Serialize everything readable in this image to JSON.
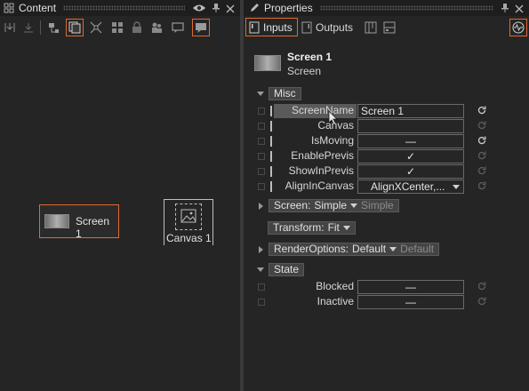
{
  "content_panel": {
    "title": "Content",
    "nodes": {
      "screen": {
        "label": "Screen 1"
      },
      "canvas": {
        "label": "Canvas 1"
      }
    }
  },
  "properties_panel": {
    "title": "Properties",
    "tabs": {
      "inputs": "Inputs",
      "outputs": "Outputs"
    },
    "object": {
      "name": "Screen 1",
      "type": "Screen"
    },
    "groups": {
      "misc": "Misc",
      "screen": {
        "label": "Screen:",
        "value": "Simple",
        "hint": "Simple"
      },
      "transform": {
        "label": "Transform:",
        "value": "Fit"
      },
      "render_options": {
        "label": "RenderOptions:",
        "value": "Default",
        "hint": "Default"
      },
      "state": "State"
    },
    "misc_props": [
      {
        "name": "ScreenName",
        "value": "Screen 1"
      },
      {
        "name": "Canvas",
        "value": ""
      },
      {
        "name": "IsMoving",
        "value": "—"
      },
      {
        "name": "EnablePrevis",
        "value": "✓"
      },
      {
        "name": "ShowInPrevis",
        "value": "✓"
      },
      {
        "name": "AlignInCanvas",
        "value": "AlignXCenter,..."
      }
    ],
    "state_props": [
      {
        "name": "Blocked",
        "value": "—"
      },
      {
        "name": "Inactive",
        "value": "—"
      }
    ]
  },
  "colors": {
    "accent": "#e06a2e",
    "background": "#252525",
    "titlebar": "#1e1e1e",
    "highlight": "#5a5a5a"
  }
}
